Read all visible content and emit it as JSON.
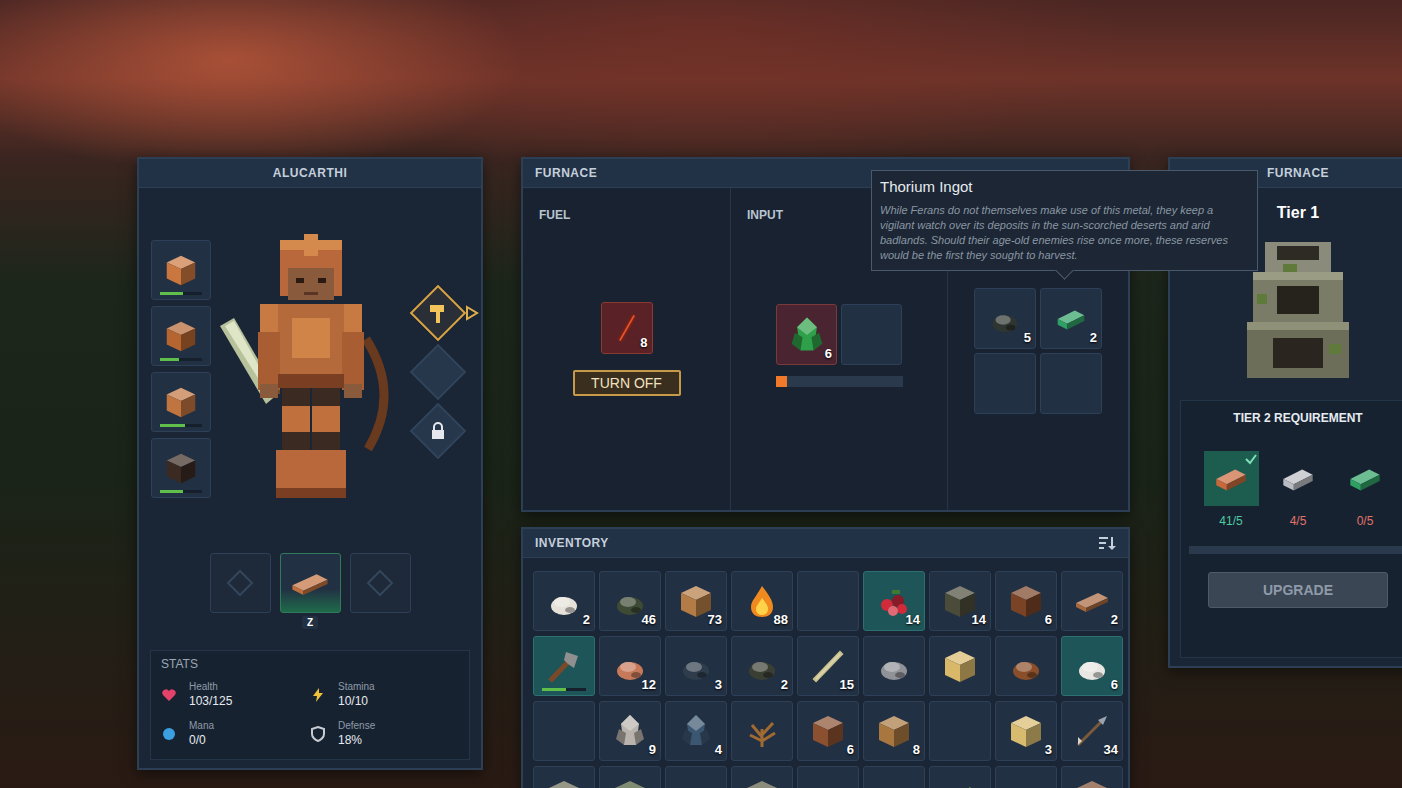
{
  "character": {
    "name": "ALUCARTHI",
    "armor": [
      {
        "durability": 0.55
      },
      {
        "durability": 0.45
      },
      {
        "durability": 0.6
      },
      {
        "durability": 0.55
      }
    ],
    "tools": [
      {
        "selected": true,
        "locked": false
      },
      {
        "selected": false,
        "locked": false
      },
      {
        "selected": false,
        "locked": true
      }
    ],
    "hotbar": [
      {
        "empty": true,
        "selected": false
      },
      {
        "empty": false,
        "selected": true,
        "key": "Z"
      },
      {
        "empty": true,
        "selected": false
      }
    ],
    "stats_title": "STATS",
    "stats": [
      {
        "label": "Health",
        "value": "103/125"
      },
      {
        "label": "Stamina",
        "value": "10/10"
      },
      {
        "label": "Mana",
        "value": "0/0"
      },
      {
        "label": "Defense",
        "value": "18%"
      }
    ]
  },
  "furnace": {
    "title": "FURNACE",
    "fuel": {
      "label": "FUEL",
      "count": "8",
      "burning": true,
      "button": "TURN OFF"
    },
    "input": {
      "label": "INPUT",
      "slots": [
        {
          "empty": false,
          "count": "6",
          "processing": true
        },
        {
          "empty": true,
          "processing": false
        }
      ],
      "level": 0.09
    },
    "output": {
      "slots": [
        {
          "empty": false,
          "count": "5"
        },
        {
          "empty": false,
          "count": "2"
        },
        {
          "empty": true
        },
        {
          "empty": true
        }
      ]
    }
  },
  "tooltip": {
    "title": "Thorium Ingot",
    "text": "While Ferans do not themselves make use of this metal, they keep a vigilant watch over its deposits in the sun-scorched deserts and arid badlands. Should their age-old enemies rise once more, these reserves would be the first they sought to harvest."
  },
  "inventory": {
    "title": "INVENTORY",
    "slots": [
      {
        "empty": false,
        "count": "2",
        "highlighted": false
      },
      {
        "empty": false,
        "count": "46",
        "highlighted": false
      },
      {
        "empty": false,
        "count": "73",
        "highlighted": false
      },
      {
        "empty": false,
        "count": "88",
        "highlighted": false
      },
      {
        "empty": true,
        "highlighted": false
      },
      {
        "empty": false,
        "count": "14",
        "highlighted": true
      },
      {
        "empty": false,
        "count": "14",
        "highlighted": false
      },
      {
        "empty": false,
        "count": "6",
        "highlighted": false
      },
      {
        "empty": false,
        "count": "2",
        "highlighted": false
      },
      {
        "empty": false,
        "highlighted": true,
        "durability": 0.55
      },
      {
        "empty": false,
        "count": "12",
        "highlighted": false
      },
      {
        "empty": false,
        "count": "3",
        "highlighted": false
      },
      {
        "empty": false,
        "count": "2",
        "highlighted": false
      },
      {
        "empty": false,
        "count": "15",
        "highlighted": false
      },
      {
        "empty": false,
        "highlighted": false
      },
      {
        "empty": false,
        "highlighted": false
      },
      {
        "empty": false,
        "highlighted": false
      },
      {
        "empty": false,
        "count": "6",
        "highlighted": true
      },
      {
        "empty": true,
        "highlighted": false
      },
      {
        "empty": false,
        "count": "9",
        "highlighted": false
      },
      {
        "empty": false,
        "count": "4",
        "highlighted": false
      },
      {
        "empty": false,
        "highlighted": false
      },
      {
        "empty": false,
        "count": "6",
        "highlighted": false
      },
      {
        "empty": false,
        "count": "8",
        "highlighted": false
      },
      {
        "empty": true,
        "highlighted": false
      },
      {
        "empty": false,
        "count": "3",
        "highlighted": false
      },
      {
        "empty": false,
        "count": "34",
        "highlighted": false
      },
      {
        "empty": false,
        "highlighted": false
      },
      {
        "empty": false,
        "highlighted": false
      },
      {
        "empty": true,
        "highlighted": false
      },
      {
        "empty": false,
        "highlighted": false
      },
      {
        "empty": true,
        "highlighted": false
      },
      {
        "empty": true,
        "highlighted": false
      },
      {
        "empty": false,
        "highlighted": false
      },
      {
        "empty": false,
        "highlighted": false
      },
      {
        "empty": false,
        "highlighted": false
      }
    ]
  },
  "upgrade": {
    "title": "FURNACE",
    "tier": "Tier 1",
    "requirement_title": "TIER 2 REQUIREMENT",
    "requirements": [
      {
        "count": "41/5",
        "met": true
      },
      {
        "count": "4/5",
        "met": false
      },
      {
        "count": "0/5",
        "met": false
      }
    ],
    "level": 0,
    "button": "UPGRADE",
    "disabled": true
  }
}
